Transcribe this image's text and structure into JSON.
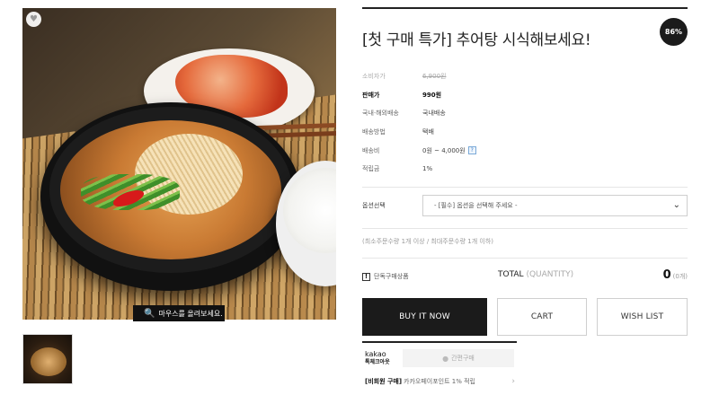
{
  "product": {
    "title": "[첫 구매 특가] 추어탕 시식해보세요!",
    "discount_badge": "86%",
    "zoom_hint": "마우스를 올려보세요.",
    "heart_icon": "heart-icon",
    "zoom_icon": "magnifier-icon"
  },
  "specs": [
    {
      "label": "소비자가",
      "value": "6,900원"
    },
    {
      "label": "판매가",
      "value": "990원"
    },
    {
      "label": "국내·해외배송",
      "value": "국내배송"
    },
    {
      "label": "배송방법",
      "value": "택배"
    },
    {
      "label": "배송비",
      "value": "0원 ~ 4,000원",
      "help": "?"
    },
    {
      "label": "적립금",
      "value": "1%"
    }
  ],
  "option": {
    "label": "옵션선택",
    "selected": "- [필수] 옵션을 선택해 주세요 -",
    "chevron": "⌄"
  },
  "limit_note": "(최소주문수량 1개 이상 / 최대주문수량 1개 이하)",
  "single_purchase": {
    "icon": "!",
    "label": "단독구매상품"
  },
  "total": {
    "label": "TOTAL",
    "qty_label": "(QUANTITY)",
    "value": "0",
    "count": "(0개)"
  },
  "buttons": {
    "buy": "BUY IT NOW",
    "cart": "CART",
    "wish": "WISH LIST"
  },
  "kakao": {
    "logo": "kakao",
    "logo_sub": "톡체크아웃",
    "buy_label": "간편구매",
    "point_highlight": "[비회원 구매]",
    "point_text": "카카오페이포인트 1% 적립",
    "arrow": "›"
  }
}
